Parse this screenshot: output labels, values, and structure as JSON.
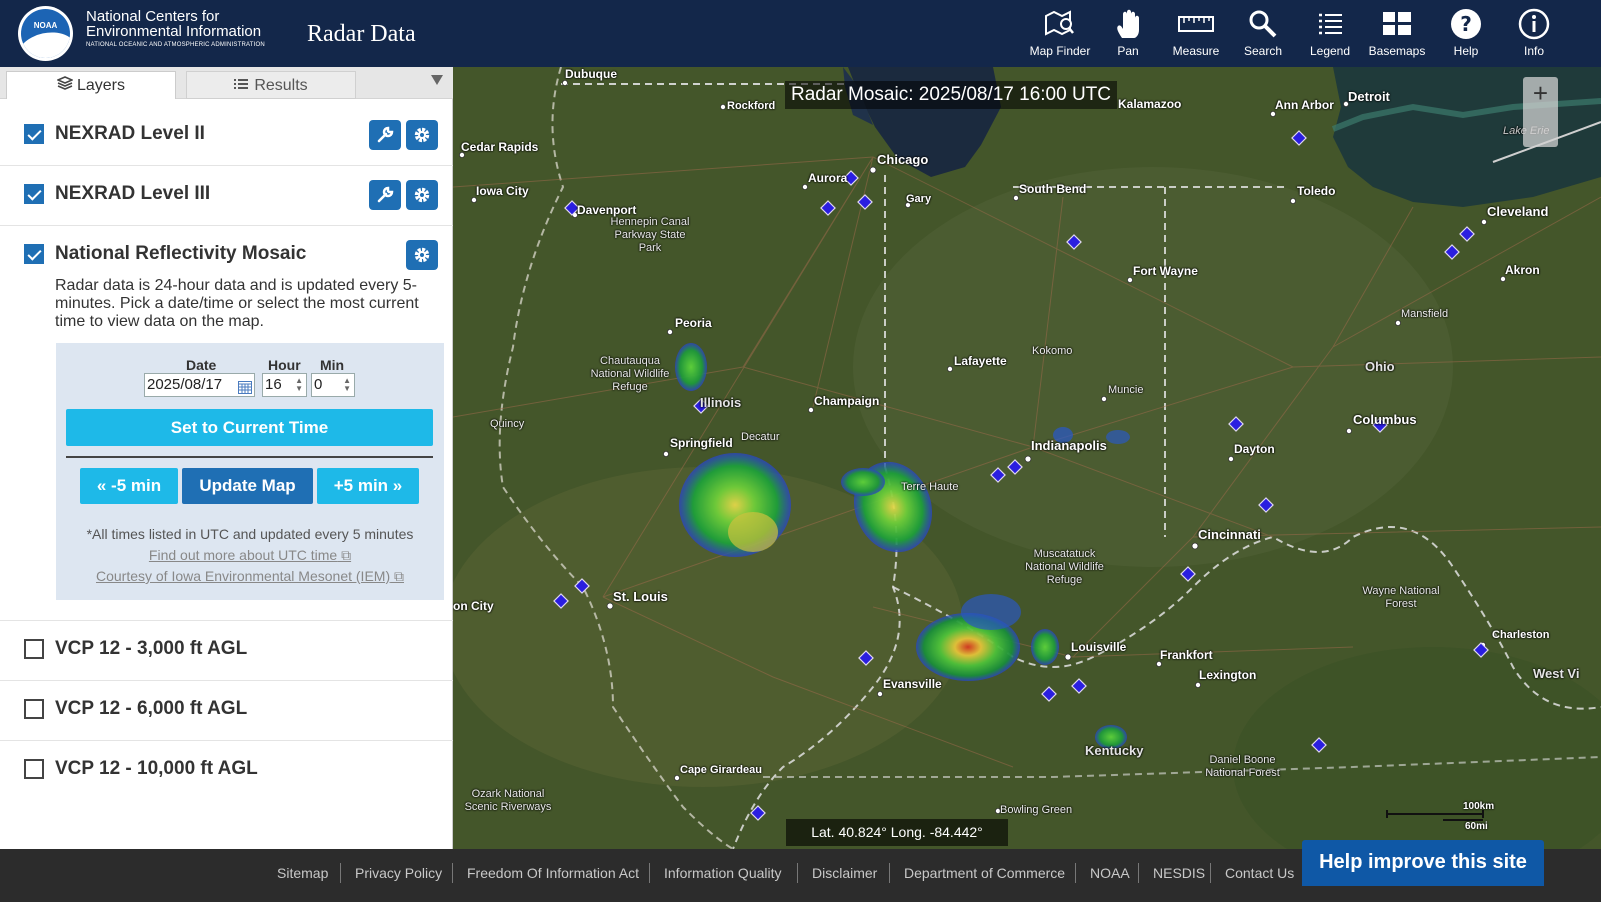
{
  "header": {
    "org_line1": "National Centers for",
    "org_line2": "Environmental Information",
    "org_line3": "NATIONAL OCEANIC AND ATMOSPHERIC ADMINISTRATION",
    "logo_text": "NOAA",
    "app_title": "Radar Data"
  },
  "toolbar": {
    "map_finder": "Map Finder",
    "pan": "Pan",
    "measure": "Measure",
    "search": "Search",
    "legend": "Legend",
    "basemaps": "Basemaps",
    "help": "Help",
    "info": "Info"
  },
  "tabs": {
    "layers": "Layers",
    "results": "Results"
  },
  "layers": {
    "nexrad2": {
      "label": "NEXRAD Level II",
      "checked": true
    },
    "nexrad3": {
      "label": "NEXRAD Level III",
      "checked": true
    },
    "mosaic": {
      "label": "National Reflectivity Mosaic",
      "checked": true,
      "description": "Radar data is 24-hour data and is updated every 5-minutes. Pick a date/time or select the most current time to view data on the map."
    },
    "vcp3000": {
      "label": "VCP 12 - 3,000 ft AGL",
      "checked": false
    },
    "vcp6000": {
      "label": "VCP 12 - 6,000 ft AGL",
      "checked": false
    },
    "vcp10000": {
      "label": "VCP 12 - 10,000 ft AGL",
      "checked": false
    }
  },
  "timecontrol": {
    "date_label": "Date",
    "hour_label": "Hour",
    "min_label": "Min",
    "date_value": "2025/08/17",
    "hour_value": "16",
    "min_value": "0",
    "set_current": "Set to Current Time",
    "minus5": "« -5 min",
    "update": "Update Map",
    "plus5": "+5 min »",
    "note": "*All times listed in UTC and updated every 5 minutes",
    "utc_link": "Find out more about UTC time",
    "iem_link": "Courtesy of Iowa Environmental Mesonet (IEM)"
  },
  "map": {
    "title": "Radar Mosaic: 2025/08/17 16:00 UTC",
    "coords": "Lat. 40.824°  Long. -84.442°",
    "zoom_in": "+",
    "scale_km": "100km",
    "scale_mi": "60mi",
    "places": [
      "Dubuque",
      "Rockford",
      "Kalamazoo",
      "Ann Arbor",
      "Detroit",
      "Cedar Rapids",
      "Chicago",
      "Aurora",
      "Gary",
      "South Bend",
      "Toledo",
      "Iowa City",
      "Davenport",
      "Cleveland",
      "Fort Wayne",
      "Akron",
      "Peoria",
      "Kokomo",
      "Lafayette",
      "Mansfield",
      "Ohio",
      "Illinois",
      "Champaign",
      "Muncie",
      "Quincy",
      "Decatur",
      "Springfield",
      "Indianapolis",
      "Dayton",
      "Columbus",
      "Terre Haute",
      "Cincinnati",
      "St. Louis",
      "Louisville",
      "Frankfort",
      "Lexington",
      "Evansville",
      "Kentucky",
      "Cape Girardeau",
      "Bowling Green",
      "Charleston",
      "West Vi",
      "Lake Erie",
      "on City"
    ],
    "areas": [
      "Hennepin Canal Parkway State Park",
      "Chautauqua National Wildlife Refuge",
      "Muscatatuck National Wildlife Refuge",
      "Wayne National Forest",
      "Daniel Boone National Forest",
      "Ozark National Scenic Riverways"
    ]
  },
  "footer": {
    "links": [
      "Sitemap",
      "Privacy Policy",
      "Freedom Of Information Act",
      "Information Quality",
      "Disclaimer",
      "Department of Commerce",
      "NOAA",
      "NESDIS",
      "Contact Us"
    ],
    "help": "Help improve this site"
  },
  "colors": {
    "header": "#13274a",
    "primary_button": "#1f6fb4",
    "cyan_button": "#1eb9e8",
    "footer": "#2c2c2c",
    "help_banner": "#0f58a6"
  }
}
